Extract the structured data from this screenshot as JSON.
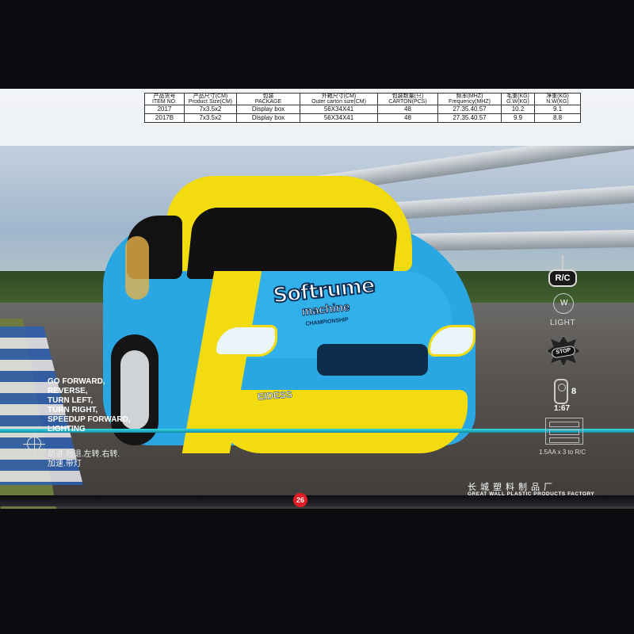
{
  "spec_table": {
    "headers": [
      {
        "cn": "产品货号",
        "en": "ITEM NO."
      },
      {
        "cn": "产品尺寸(CM)",
        "en": "Product Size(CM)"
      },
      {
        "cn": "包装",
        "en": "PACKAGE"
      },
      {
        "cn": "外箱尺寸(CM)",
        "en": "Outer carton size(CM)"
      },
      {
        "cn": "包装数量(只)",
        "en": "CARTON(PCS)"
      },
      {
        "cn": "频率(MHZ)",
        "en": "Frequency(MHZ)"
      },
      {
        "cn": "毛重(KG)",
        "en": "G.W(KG)"
      },
      {
        "cn": "净重(KG)",
        "en": "N.W(KG)"
      }
    ],
    "rows": [
      [
        "2017",
        "7x3.5x2",
        "Display box",
        "56X34X41",
        "48",
        "27.35.40.57",
        "10.2",
        "9.1"
      ],
      [
        "2017B",
        "7x3.5x2",
        "Display box",
        "56X34X41",
        "48",
        "27.35.40.57",
        "9.9",
        "8.8"
      ]
    ]
  },
  "car_graphics": {
    "logo_main": "Softrume",
    "logo_sub": "machine",
    "logo_tag": "CHAMPIONSHIP",
    "side_text": "EIDESS"
  },
  "features": {
    "en_lines": [
      "GO FORWARD,",
      "REVERSE,",
      "TURN LEFT,",
      "TURN RIGHT,",
      "SPEEDUP FORWARD,",
      "LIGHTING"
    ],
    "cn_lines": [
      "前进.后退.左转.右转.",
      "加速.带灯"
    ]
  },
  "icons": {
    "rc_label": "R/C",
    "light_label": "LIGHT",
    "stop_label": "STOP",
    "eight_label": "8",
    "scale_label": "1:67",
    "battery_label": "1.5AA x 3 to R/C"
  },
  "footer": {
    "page_number": "26",
    "company_cn": "长城塑料制品厂",
    "company_en": "GREAT WALL PLASTIC PRODUCTS FACTORY"
  },
  "colors": {
    "car_blue": "#2aa6e2",
    "car_yellow": "#f2dc0f",
    "accent_teal": "#3ad8e4",
    "page_badge_red": "#e11c24"
  }
}
